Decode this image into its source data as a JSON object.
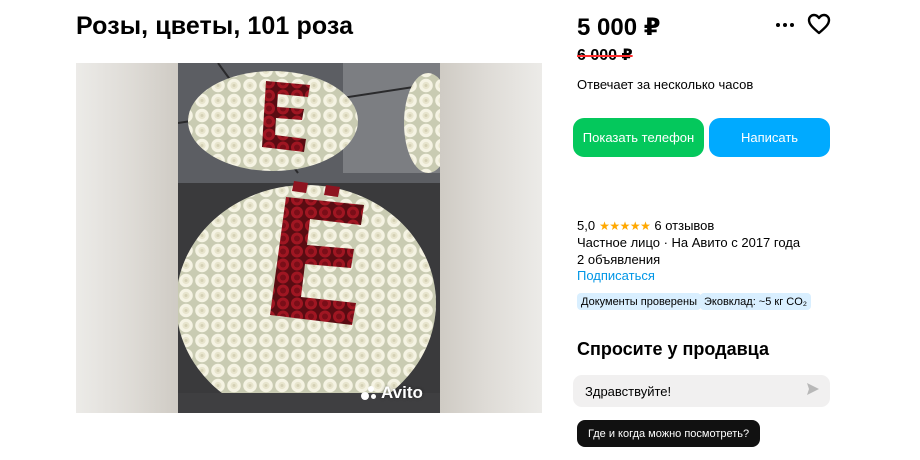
{
  "listing": {
    "title": "Розы, цветы, 101 роза",
    "price": "5 000 ₽",
    "old_price": "6 000 ₽",
    "response_time": "Отвечает за несколько часов",
    "watermark": "Avito"
  },
  "actions": {
    "show_phone": "Показать телефон",
    "write": "Написать",
    "more_icon": "more-dots-icon",
    "favorite_icon": "heart-icon"
  },
  "seller": {
    "rating": "5,0",
    "stars": "★★★★★",
    "reviews": "6 отзывов",
    "type_line": "Частное лицо · На Авито с 2017 года",
    "ads_count": "2 объявления",
    "subscribe": "Подписаться",
    "badges": [
      "Документы проверены",
      "Эковклад: ~5 кг CO₂"
    ]
  },
  "ask": {
    "title": "Спросите у продавца",
    "message_value": "Здравствуйте!",
    "send_icon": "send-icon",
    "quick_question": "Где и когда можно посмотреть?"
  },
  "colors": {
    "green_button": "#04c85c",
    "blue_button": "#00aaff",
    "link": "#0096e6",
    "stars": "#ffa800",
    "strike": "#ff2d2d"
  }
}
